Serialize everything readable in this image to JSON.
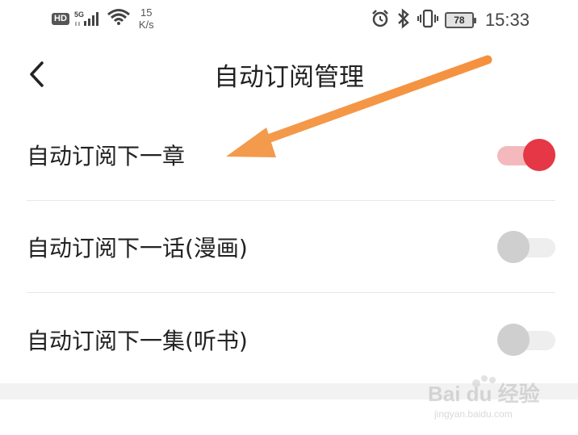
{
  "status_bar": {
    "hd_badge": "HD",
    "network": "5G",
    "speed_value": "15",
    "speed_unit": "K/s",
    "battery": "78",
    "time": "15:33",
    "icons": [
      "signal-icon",
      "wifi-icon",
      "alarm-icon",
      "bluetooth-icon",
      "vibrate-icon",
      "battery-icon"
    ]
  },
  "header": {
    "back_icon": "chevron-left-icon",
    "title": "自动订阅管理"
  },
  "settings": [
    {
      "label": "自动订阅下一章",
      "enabled": true
    },
    {
      "label": "自动订阅下一话(漫画)",
      "enabled": false
    },
    {
      "label": "自动订阅下一集(听书)",
      "enabled": false
    }
  ],
  "annotation": {
    "type": "arrow",
    "color": "#F5913E",
    "points_to": "自动订阅下一章"
  },
  "watermark": {
    "brand": "Bai du 经验",
    "url": "jingyan.baidu.com"
  },
  "colors": {
    "toggle_on_knob": "#E53745",
    "toggle_on_track": "#F4B9BD",
    "toggle_off_knob": "#CFCFCF",
    "toggle_off_track": "#EEEEEE"
  }
}
